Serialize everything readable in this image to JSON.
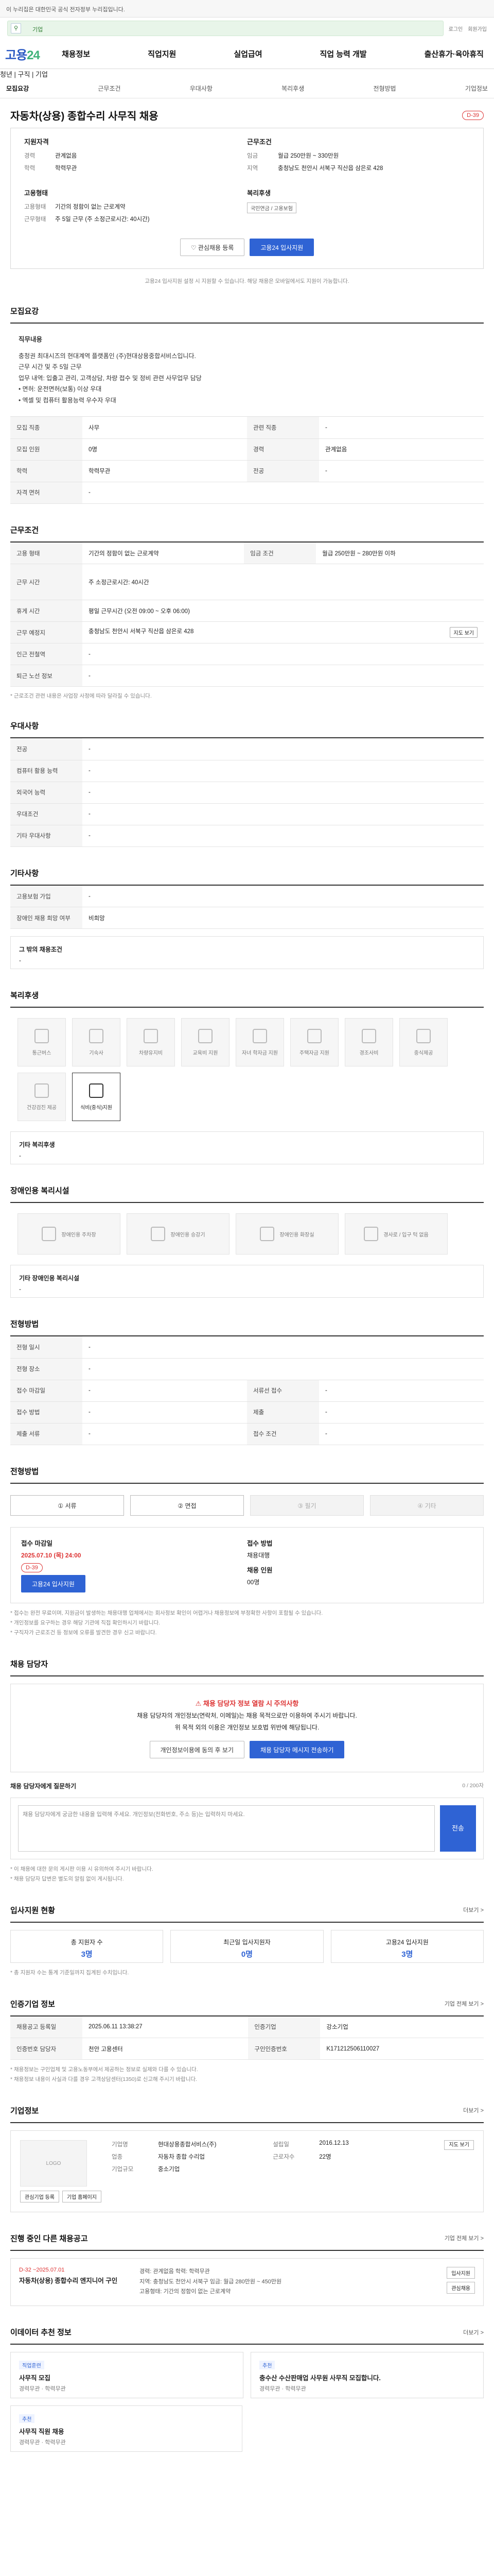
{
  "banner": {
    "text": "이 누리집은 대한민국 공식 전자정부 누리집입니다."
  },
  "top": {
    "search_label": "기업",
    "login": "로그인",
    "join": "회원가입"
  },
  "header": {
    "logo_main": "고용",
    "logo_sub": "24",
    "menu": [
      "채용정보",
      "직업지원",
      "실업급여",
      "직업 능력 개발",
      "출산휴가·육아휴직"
    ],
    "mini_links": "청년  |  구직  |  기업"
  },
  "tabs": [
    "모집요강",
    "근무조건",
    "우대사항",
    "복리후생",
    "전형방법",
    "기업정보"
  ],
  "job": {
    "title": "자동차(상용) 종합수리 사무직 채용",
    "dday": "D-39",
    "company_h": "지원자격",
    "company_rows": [
      {
        "k": "경력",
        "v": "관계없음"
      },
      {
        "k": "학력",
        "v": "학력무관"
      }
    ],
    "cond_h": "근무조건",
    "cond_rows": [
      {
        "k": "임금",
        "v": "월급 250만원 ~ 330만원"
      },
      {
        "k": "지역",
        "v": "충청남도 천안시 서북구 직산읍 삼은로 428"
      }
    ],
    "type_h": "고용형태",
    "type_rows": [
      {
        "k": "고용형태",
        "v": "기간의 정함이 없는 근로계약"
      },
      {
        "k": "근무형태",
        "v": "주 5일 근무 (주 소정근로시간: 40시간)"
      }
    ],
    "welfare_h": "복리후생",
    "welfare_chip": "국민연금 / 고용보험",
    "btn_scrap": "관심채용 등록",
    "btn_apply": "고용24 입사지원",
    "notice": "고용24 입사지원 설정 시 지원할 수 있습니다. 해당 채용은 모바일에서도 지원이 가능합니다."
  },
  "recruit": {
    "h": "모집요강",
    "box_h": "직무내용",
    "box_lines": [
      "충청권 최대시즈의 현대계역 플랫폼인 (주)현대상용중합서비스입니다.",
      "근무 시간 및 주 5일 근무",
      "업무 내역: 입출고 관리, 고객상담, 차량 접수 및 정비 관련 사무업무 담당",
      "• 면허: 운전면허(보통) 이상 우대",
      "• 엑셀 및 컴퓨터 활용능력 우수자 우대"
    ],
    "rows": [
      {
        "k": "모집 직종",
        "v": "사무",
        "k2": "관련 직종",
        "v2": "-"
      },
      {
        "k": "모집 인원",
        "v": "0명",
        "k2": "경력",
        "v2": "관계없음"
      },
      {
        "k": "학력",
        "v": "학력무관",
        "k2": "전공",
        "v2": "-"
      },
      {
        "k": "자격 면허",
        "v": "-",
        "k2": "",
        "v2": ""
      }
    ]
  },
  "work": {
    "h": "근무조건",
    "rows": [
      {
        "k": "고용 형태",
        "v": "기간의 정함이 없는 근로계약",
        "k2": "임금 조건",
        "v2": "월급 250만원 ~ 280만원 이하"
      },
      {
        "k": "근무 시간",
        "v": "주 소정근로시간: 40시간",
        "k2": "",
        "v2": ""
      },
      {
        "k": "휴게 시간",
        "v": "평일 근무시간 (오전 09:00 ~ 오후 06:00)",
        "k2": "",
        "v2": ""
      },
      {
        "k": "근무 예정지",
        "v": "충청남도 천안시 서북구 직산읍 삼은로 428",
        "k2": "",
        "v2": ""
      },
      {
        "k": "인근 전철역",
        "v": "-",
        "k2": "",
        "v2": ""
      },
      {
        "k": "퇴근 노선 정보",
        "v": "-",
        "k2": "",
        "v2": ""
      }
    ],
    "map_btn": "지도 보기",
    "note": "* 근로조건 관련 내용은 사업장 사정에 따라 달라질 수 있습니다."
  },
  "pref": {
    "h": "우대사항",
    "rows": [
      {
        "k": "전공",
        "v": "-"
      },
      {
        "k": "컴퓨터 활용 능력",
        "v": "-"
      },
      {
        "k": "외국어 능력",
        "v": "-"
      },
      {
        "k": "우대조건",
        "v": "-"
      },
      {
        "k": "기타 우대사항",
        "v": "-"
      }
    ]
  },
  "etc": {
    "h": "기타사항",
    "rows": [
      {
        "k": "고용보험 가입",
        "v": "-"
      },
      {
        "k": "장애인 채용 희망 여부",
        "v": "비희망"
      }
    ],
    "box_h": "그 밖의 채용조건",
    "box_v": "-"
  },
  "welfare": {
    "h": "복리후생",
    "items": [
      {
        "label": "통근버스",
        "on": false
      },
      {
        "label": "기숙사",
        "on": false
      },
      {
        "label": "차량유지비",
        "on": false
      },
      {
        "label": "교육비 지원",
        "on": false
      },
      {
        "label": "자녀 학자금 지원",
        "on": false
      },
      {
        "label": "주택자금 지원",
        "on": false
      },
      {
        "label": "경조사비",
        "on": false
      },
      {
        "label": "중식제공",
        "on": false
      },
      {
        "label": "건강검진 제공",
        "on": false
      },
      {
        "label": "식비(중식)지원",
        "on": true
      }
    ],
    "other_h": "기타 복리후생",
    "other_v": "-"
  },
  "disabled": {
    "h": "장애인용 복리시설",
    "items": [
      "장애인용 주차장",
      "장애인용 승강기",
      "장애인용 화장실",
      "경사로 / 입구 턱 없음"
    ],
    "other_h": "기타 장애인용 복리시설",
    "other_v": "-"
  },
  "process": {
    "h": "전형방법",
    "rows": [
      {
        "k": "전형 일시",
        "v": "-"
      },
      {
        "k": "전형 장소",
        "v": "-"
      },
      {
        "k": "접수 마감일",
        "v": "-",
        "k2": "서류선 접수",
        "v2": "-"
      },
      {
        "k": "접수 방법",
        "v": "-",
        "k2": "제출",
        "v2": "-"
      },
      {
        "k": "제출 서류",
        "v": "-",
        "k2": "접수 조건",
        "v2": "-"
      }
    ],
    "steps": [
      {
        "label": "① 서류",
        "dim": false
      },
      {
        "label": "② 면접",
        "dim": false
      },
      {
        "label": "③ 필기",
        "dim": true
      },
      {
        "label": "④ 기타",
        "dim": true
      }
    ]
  },
  "apply": {
    "l_h": "접수 마감일",
    "l_v": "2025.07.10 (목) 24:00",
    "l_badge": "D-39",
    "l_btn": "고용24 입사지원",
    "r_h": "접수 방법",
    "r_v": "채용대행",
    "r_h2": "채용 인원",
    "r_v2": "00명",
    "notes": [
      "* 접수는 완전 무료이며, 지원금이 발생하는 채용대행 업체에서는 회사정보 확인이 어렵거나 채용정보에 부정확한 사항이 포함될 수 있습니다.",
      "* 개인정보를 요구하는 경우 해당 기관에 직접 확인하시기 바랍니다.",
      "* 구직자가 근로조건 등 정보에 오류를 발견한 경우 신고 바랍니다."
    ]
  },
  "contact": {
    "h": "채용 담당자",
    "warn": "채용 담당자 정보 열람 시 주의사항",
    "lines": [
      "채용 담당자의 개인정보(연락처, 이메일)는 채용 목적으로만 이용하여 주시기 바랍니다.",
      "위 목적 외의 이용은 개인정보 보호법 위반에 해당됩니다."
    ],
    "btn_a": "개인정보이용에 동의 후 보기",
    "btn_b": "채용 담당자 메시지 전송하기",
    "msg_h": "채용 담당자에게 질문하기",
    "msg_count": "0 / 200자",
    "msg_ph": "채용 담당자에게 궁금한 내용을 입력해 주세요. 개인정보(전화번호, 주소 등)는 입력하지 마세요.",
    "msg_send": "전송",
    "msg_notes": [
      "* 이 채용에 대한 문의 게시판 이용 시 유의하여 주시기 바랍니다.",
      "* 채용 담당자 답변은 별도의 알림 없이 게시됩니다."
    ]
  },
  "stats": {
    "h": "입사지원 현황",
    "more": "더보기 >",
    "items": [
      {
        "label": "총 지원자 수",
        "v": "3명"
      },
      {
        "label": "최근일 입사지원자",
        "v": "0명"
      },
      {
        "label": "고용24 입사지원",
        "v": "3명"
      }
    ],
    "note": "* 총 지원자 수는 통계 기준일까지 집계된 수치입니다."
  },
  "process2": {
    "h": "인증기업 정보",
    "more": "기업 전체 보기 >",
    "rows": [
      {
        "k": "채용공고 등록일",
        "v": "2025.06.11 13:38:27",
        "k2": "인증기업",
        "v2": "강소기업"
      },
      {
        "k": "인증번호 담당자",
        "v": "천안 고용센터",
        "k2": "구인인증번호",
        "v2": "K171212506110027"
      }
    ],
    "notes": [
      "* 채용정보는 구인업체 및 고용노동부에서 제공하는 정보로 실제와 다를 수 있습니다.",
      "* 채용정보 내용이 사실과 다를 경우 고객상담센터(1350)로 신고해 주시기 바랍니다."
    ]
  },
  "company": {
    "h": "기업정보",
    "more": "더보기 >",
    "logo": "LOGO",
    "rows": [
      {
        "k": "기업명",
        "v": "현대상용종합서비스(주)",
        "k2": "설립일",
        "v2": "2016.12.13"
      },
      {
        "k": "업종",
        "v": "자동차 종합 수리업",
        "k2": "근로자수",
        "v2": "22명"
      },
      {
        "k": "기업규모",
        "v": "중소기업",
        "k2": "",
        "v2": ""
      }
    ],
    "btn_a": "관심기업 등록",
    "btn_b": "기업 홈페이지",
    "map_btn": "지도 보기"
  },
  "other_jobs": {
    "h": "진행 중인 다른 채용공고",
    "more": "기업 전체 보기 >",
    "date": "D-32  ~2025.07.01",
    "title": "자동차(상용) 종합수리 엔지니어 구인",
    "meta": [
      "경력: 관계없음    학력: 학력무관",
      "지역: 충청남도 천안시 서북구    임금: 월급 280만원 ~ 450만원",
      "고용형태: 기간의 정함이 없는 근로계약"
    ],
    "btn_a": "입사지원",
    "btn_b": "관심채용"
  },
  "related": {
    "h": "이데이터 추천 정보",
    "more": "더보기 >",
    "cards": [
      {
        "tag": "직업훈련",
        "title": "사무직 모집",
        "sub": "경력무관 · 학력무관"
      },
      {
        "tag": "추천",
        "title": "충수산 수산판매업 사무원 사무직 모집합니다.",
        "sub": "경력무관 · 학력무관"
      },
      {
        "tag": "추천",
        "title": "사무직 직원 채용",
        "sub": "경력무관 · 학력무관"
      }
    ]
  }
}
